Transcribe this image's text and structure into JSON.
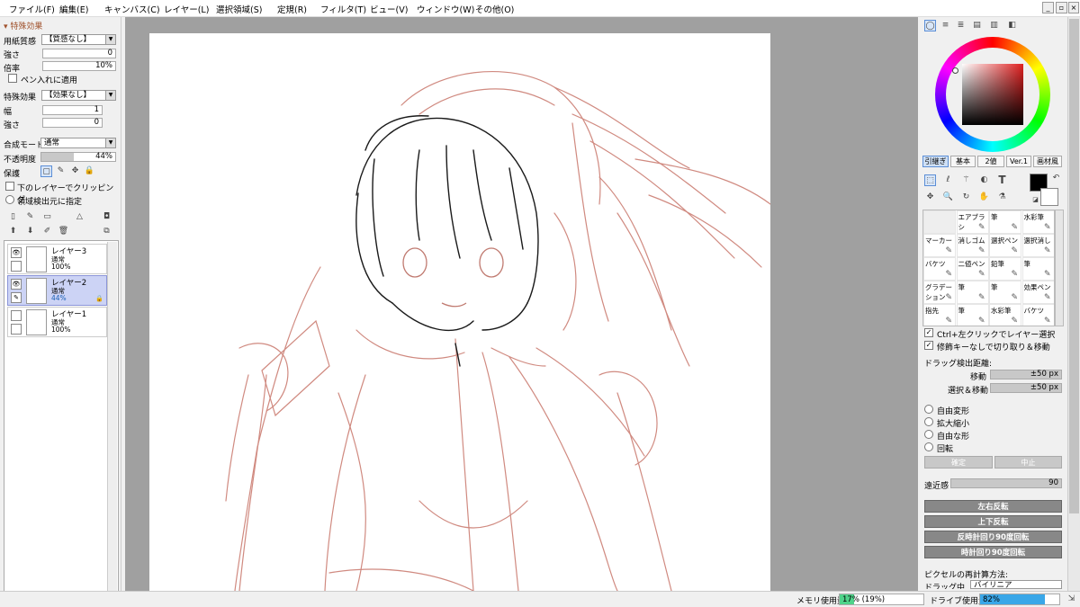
{
  "menu": [
    "ファイル(F)",
    "編集(E)",
    "キャンバス(C)",
    "レイヤー(L)",
    "選択領域(S)",
    "定規(R)",
    "フィルタ(T)",
    "ビュー(V)",
    "ウィンドウ(W)",
    "その他(O)"
  ],
  "left": {
    "section_title": "特殊効果",
    "paper_label": "用紙質感",
    "paper_value": "【質感なし】",
    "strength_label": "強さ",
    "strength_value": "0",
    "scale_label": "倍率",
    "scale_value": "10%",
    "pen_apply": "ペン入れに適用",
    "effect_label": "特殊効果",
    "effect_value": "【効果なし】",
    "width_label": "幅",
    "width_value": "1",
    "strength2_label": "強さ",
    "strength2_value": "0",
    "blend_label": "合成モード",
    "blend_value": "通常",
    "opacity_label": "不透明度",
    "opacity_value": "44%",
    "opacity_fraction": 0.44,
    "protect_label": "保護",
    "clip_label": "下のレイヤーでクリッピング",
    "detect_label": "領域検出元に指定"
  },
  "layers": [
    {
      "name": "レイヤー3",
      "mode": "通常",
      "opacity": "100%"
    },
    {
      "name": "レイヤー2",
      "mode": "通常",
      "opacity": "44%"
    },
    {
      "name": "レイヤー1",
      "mode": "通常",
      "opacity": "100%"
    }
  ],
  "right": {
    "tool_tabs": [
      "引継ぎ",
      "基本",
      "2値",
      "Ver.1",
      "画材風"
    ],
    "text_tool": "T",
    "brushes": [
      [
        "",
        "エアブラシ",
        "筆",
        "水彩筆"
      ],
      [
        "マーカー",
        "消しゴム",
        "選択ペン",
        "選択消し"
      ],
      [
        "バケツ",
        "二値ペン",
        "鉛筆",
        "筆"
      ],
      [
        "グラデーション",
        "筆",
        "筆",
        "効果ペン"
      ],
      [
        "指先",
        "筆",
        "水彩筆",
        "バケツ"
      ]
    ],
    "ctrl_click": "Ctrl+左クリックでレイヤー選択",
    "modifier": "修飾キーなしで切り取り＆移動",
    "drag_label": "ドラッグ検出距離:",
    "move_label": "移動",
    "move_value": "±50 px",
    "select_move_label": "選択＆移動",
    "select_move_value": "±50 px",
    "transforms": [
      "自由変形",
      "拡大縮小",
      "自由な形",
      "回転"
    ],
    "confirm": "確定",
    "cancel": "中止",
    "perspective_label": "遠近感",
    "perspective_value": "90",
    "flip_h": "左右反転",
    "flip_v": "上下反転",
    "rot_ccw": "反時計回り90度回転",
    "rot_cw": "時計回り90度回転",
    "resample_label": "ピクセルの再計算方法:",
    "drag_partial": "ドラッグ中",
    "resample_value": "バイリニア"
  },
  "status": {
    "memory_label": "メモリ使用量",
    "memory_value": "17% (19%)",
    "memory_fraction": 0.17,
    "drive_label": "ドライブ使用量",
    "drive_value": "82%",
    "drive_fraction": 0.82
  }
}
